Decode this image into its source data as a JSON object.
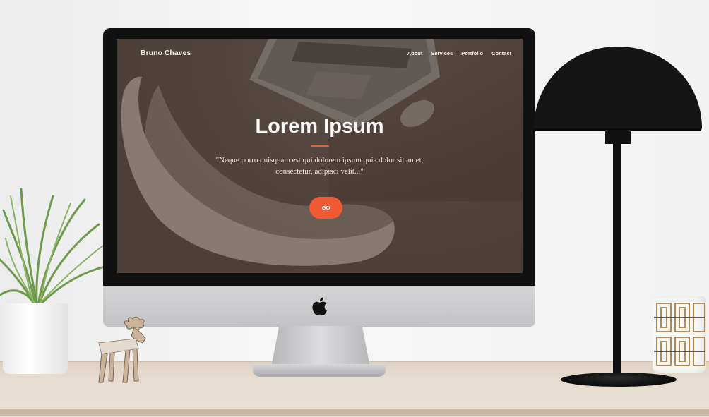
{
  "site": {
    "brand": "Bruno Chaves",
    "nav": [
      "About",
      "Services",
      "Portfolio",
      "Contact"
    ]
  },
  "hero": {
    "title": "Lorem Ipsum",
    "quote": "\"Neque porro quisquam est qui dolorem ipsum quia dolor sit amet, consectetur, adipisci velit...\"",
    "button_label": "GO"
  },
  "colors": {
    "accent": "#ee5a33",
    "overlay": "#4e433c",
    "monitor_bezel": "#111111",
    "lamp": "#111111"
  },
  "icons": {
    "monitor_logo": "apple-icon"
  }
}
